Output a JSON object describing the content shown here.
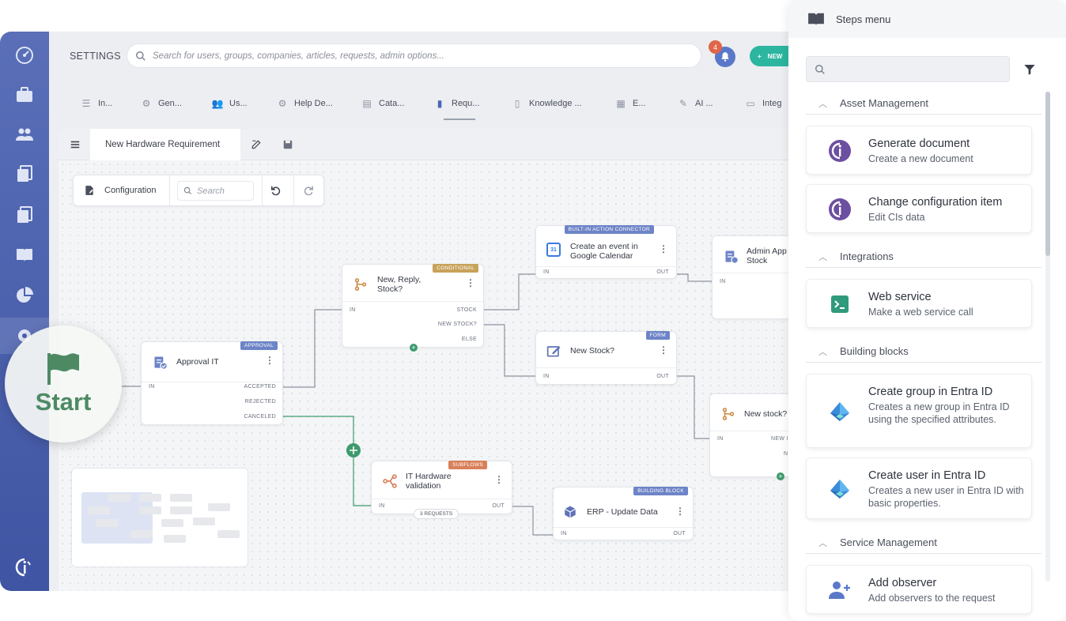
{
  "topbar": {
    "settings_label": "SETTINGS",
    "search_placeholder": "Search for users, groups, companies, articles, requests, admin options...",
    "notification_count": "4",
    "new_button": "NEW"
  },
  "tabs": [
    {
      "label": "In..."
    },
    {
      "label": "Gen..."
    },
    {
      "label": "Us..."
    },
    {
      "label": "Help De..."
    },
    {
      "label": "Cata..."
    },
    {
      "label": "Requ..."
    },
    {
      "label": "Knowledge ..."
    },
    {
      "label": "E..."
    },
    {
      "label": "AI ..."
    },
    {
      "label": "Integ"
    }
  ],
  "editor": {
    "tab_title": "New Hardware Requirement",
    "config_label": "Configuration",
    "search_placeholder": "Search"
  },
  "start": {
    "label": "Start"
  },
  "nodes": {
    "approval": {
      "title": "Approval IT",
      "badge": "APPROVAL",
      "in": "IN",
      "out1": "ACCEPTED",
      "out2": "REJECTED",
      "out3": "CANCELED"
    },
    "conditional": {
      "title": "New, Reply, Stock?",
      "badge": "CONDITIONAL",
      "in": "IN",
      "out1": "STOCK",
      "out2": "NEW STOCK?",
      "out3": "ELSE"
    },
    "calendar": {
      "title": "Create an event in Google Calendar",
      "badge": "BUILT-IN ACTION CONNECTOR",
      "in": "IN",
      "out": "OUT",
      "icon_text": "31"
    },
    "form": {
      "title": "New Stock?",
      "badge": "FORM",
      "in": "IN",
      "out": "OUT"
    },
    "subflow": {
      "title": "IT Hardware validation",
      "badge": "SUBFLOWS",
      "in": "IN",
      "out": "OUT",
      "requests": "3 REQUESTS"
    },
    "erp": {
      "title": "ERP - Update Data",
      "badge": "BUILDING BLOCK",
      "in": "IN",
      "out": "OUT"
    },
    "admin": {
      "title": "Admin App Stock",
      "in": "IN"
    },
    "newstock2": {
      "title": "New stock?",
      "in": "IN",
      "out1": "NEW I",
      "out2": "N"
    }
  },
  "panel": {
    "title": "Steps menu",
    "sections": [
      {
        "name": "Asset Management",
        "items": [
          {
            "title": "Generate document",
            "desc": "Create a new document",
            "icon": "invgate-icon"
          },
          {
            "title": "Change configuration item",
            "desc": "Edit CIs data",
            "icon": "invgate-icon"
          }
        ]
      },
      {
        "name": "Integrations",
        "items": [
          {
            "title": "Web service",
            "desc": "Make a web service call",
            "icon": "terminal-icon"
          }
        ]
      },
      {
        "name": "Building blocks",
        "items": [
          {
            "title": "Create group in Entra ID",
            "desc": "Creates a new group in Entra ID using the specified attributes.",
            "icon": "entra-id-icon"
          },
          {
            "title": "Create user in Entra ID",
            "desc": "Creates a new user in Entra ID with basic properties.",
            "icon": "entra-id-icon"
          }
        ]
      },
      {
        "name": "Service Management",
        "items": [
          {
            "title": "Add observer",
            "desc": "Add observers to the request",
            "icon": "add-user-icon"
          }
        ]
      }
    ]
  },
  "colors": {
    "sidebar": "#4a5fae",
    "accent_teal": "#2cb6a0",
    "badge_blue": "#6d84c7",
    "badge_gold": "#c8a25a",
    "badge_orange": "#d9805a",
    "start_green": "#4d8a64"
  }
}
